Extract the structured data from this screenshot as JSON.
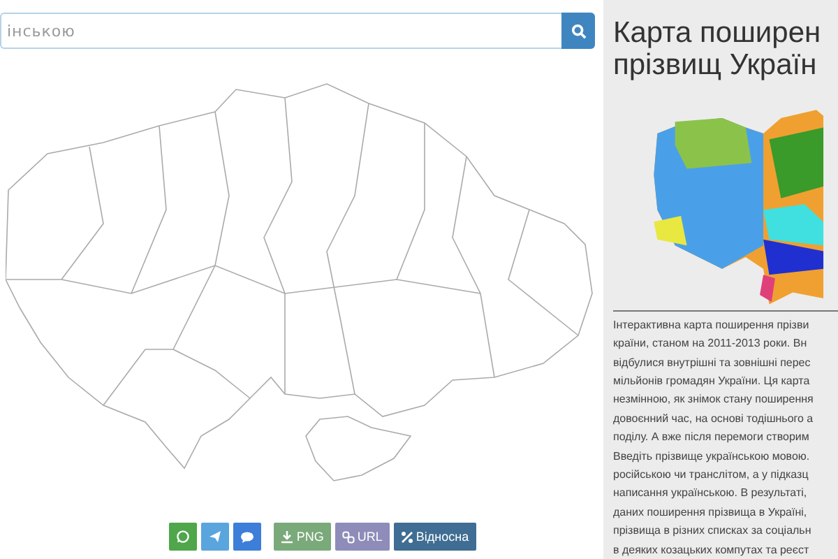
{
  "search": {
    "placeholder": "інською"
  },
  "share_buttons": [
    {
      "kind": "whatsapp"
    },
    {
      "kind": "telegram"
    },
    {
      "kind": "chat"
    },
    {
      "kind": "png",
      "label": "PNG"
    },
    {
      "kind": "url",
      "label": "URL"
    },
    {
      "kind": "relative",
      "label": "Відносна"
    }
  ],
  "sidebar": {
    "title_lines": [
      "Карта поширен",
      "прізвищ Україн"
    ],
    "text_lines": [
      "Інтерактивна карта поширення прізви",
      "країни, станом на 2011-2013 роки. Вн",
      "відбулися внутрішні та зовнішні перес",
      "мільйонів громадян України. Ця карта",
      "незмінною, як знімок стану поширення",
      "довоєнний час, на основі тодішнього а",
      "поділу. А вже після перемоги створим",
      "Введіть прізвище українською мовою.",
      "російською чи транслітом, а у підказц",
      "написання українською. В результаті,",
      "даних поширення прізвища в Україні,",
      "прізвища в різних списках за соціальн",
      "в деяких козацьких компутах та реєст"
    ]
  }
}
